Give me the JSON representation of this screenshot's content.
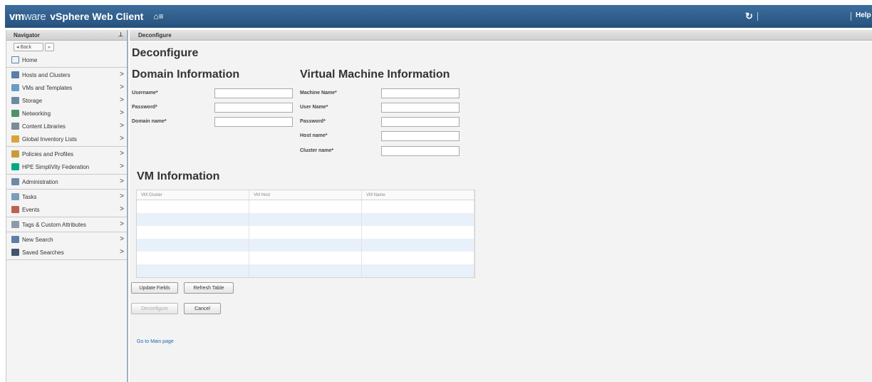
{
  "header": {
    "brand_vm": "vm",
    "brand_ware": "ware",
    "product": "vSphere Web Client",
    "home_glyph": "⌂≡",
    "refresh_glyph": "↻",
    "help": "Help"
  },
  "navigator": {
    "title": "Navigator",
    "back_label": "◂ Back",
    "forward_label": "▸",
    "home_label": "Home",
    "groups": [
      [
        {
          "label": "Hosts and Clusters",
          "icon": "hosts-icon",
          "color": "#5a7fa8"
        },
        {
          "label": "VMs and Templates",
          "icon": "vms-icon",
          "color": "#6a9bc7"
        },
        {
          "label": "Storage",
          "icon": "storage-icon",
          "color": "#6d8aa3"
        },
        {
          "label": "Networking",
          "icon": "networking-icon",
          "color": "#4f8f6a"
        },
        {
          "label": "Content Libraries",
          "icon": "content-library-icon",
          "color": "#7a8b99"
        },
        {
          "label": "Global Inventory Lists",
          "icon": "inventory-icon",
          "color": "#d8a43a"
        }
      ],
      [
        {
          "label": "Policies and Profiles",
          "icon": "policies-icon",
          "color": "#c99b3c"
        },
        {
          "label": "HPE SimpliVity Federation",
          "icon": "hpe-icon",
          "color": "#01a982"
        }
      ],
      [
        {
          "label": "Administration",
          "icon": "administration-icon",
          "color": "#6f88a8"
        }
      ],
      [
        {
          "label": "Tasks",
          "icon": "tasks-icon",
          "color": "#7c9cbb"
        },
        {
          "label": "Events",
          "icon": "events-icon",
          "color": "#c06050"
        }
      ],
      [
        {
          "label": "Tags & Custom Attributes",
          "icon": "tag-icon",
          "color": "#8a9aa8"
        }
      ],
      [
        {
          "label": "New Search",
          "icon": "search-icon",
          "color": "#5a7fa8"
        },
        {
          "label": "Saved Searches",
          "icon": "saved-search-icon",
          "color": "#40566e"
        }
      ]
    ]
  },
  "tab": {
    "label": "Deconfigure"
  },
  "page": {
    "title": "Deconfigure"
  },
  "domain": {
    "heading": "Domain Information",
    "username_label": "Username*",
    "username_value": "",
    "password_label": "Password*",
    "password_value": "",
    "domain_label": "Domain name*",
    "domain_value": ""
  },
  "vm_info": {
    "heading": "Virtual Machine Information",
    "machine_label": "Machine Name*",
    "machine_value": "",
    "user_label": "User Name*",
    "user_value": "",
    "password_label": "Password*",
    "password_value": "",
    "host_label": "Host name*",
    "host_value": "",
    "cluster_label": "Cluster name*",
    "cluster_value": ""
  },
  "vm_table": {
    "heading": "VM Information",
    "columns": [
      "VM Cluster",
      "VM Host",
      "VM Name"
    ],
    "rows": 6
  },
  "buttons": {
    "update": "Update Fields",
    "refresh": "Refresh Table",
    "deconfigure": "Deconfigure",
    "cancel": "Cancel"
  },
  "footer": {
    "link": "Go to Main page"
  }
}
